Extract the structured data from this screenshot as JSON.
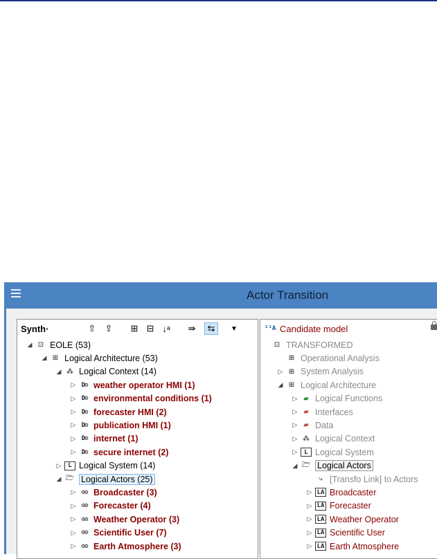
{
  "dialog": {
    "title": "Actor Transition"
  },
  "left": {
    "toolbar_label": "Synth·",
    "tree": [
      {
        "label": "EOLE (53)",
        "icon": "project-icon",
        "depth": 0,
        "toggle": "open",
        "style": "plain"
      },
      {
        "label": "Logical Architecture (53)",
        "icon": "architecture-icon",
        "depth": 1,
        "toggle": "open",
        "style": "plain"
      },
      {
        "label": "Logical Context (14)",
        "icon": "context-icon",
        "depth": 2,
        "toggle": "open",
        "style": "plain"
      },
      {
        "label": "weather operator HMI (1)",
        "icon": "component-icon",
        "depth": 3,
        "toggle": "closed",
        "style": "red"
      },
      {
        "label": "environmental conditions (1)",
        "icon": "component-icon",
        "depth": 3,
        "toggle": "closed",
        "style": "red"
      },
      {
        "label": "forecaster HMI (2)",
        "icon": "component-icon",
        "depth": 3,
        "toggle": "closed",
        "style": "red"
      },
      {
        "label": "publication HMI (1)",
        "icon": "component-icon",
        "depth": 3,
        "toggle": "closed",
        "style": "red"
      },
      {
        "label": "internet (1)",
        "icon": "component-icon",
        "depth": 3,
        "toggle": "closed",
        "style": "red"
      },
      {
        "label": "secure internet (2)",
        "icon": "component-icon",
        "depth": 3,
        "toggle": "closed",
        "style": "red"
      },
      {
        "label": "Logical System (14)",
        "icon": "logical-system-icon",
        "depth": 2,
        "toggle": "closed",
        "style": "plain"
      },
      {
        "label": "Logical Actors (25)",
        "icon": "folder-open-icon",
        "depth": 2,
        "toggle": "open",
        "style": "selected"
      },
      {
        "label": "Broadcaster (3)",
        "icon": "actor-icon",
        "depth": 3,
        "toggle": "closed",
        "style": "red"
      },
      {
        "label": "Forecaster (4)",
        "icon": "actor-icon",
        "depth": 3,
        "toggle": "closed",
        "style": "red"
      },
      {
        "label": "Weather Operator (3)",
        "icon": "actor-icon",
        "depth": 3,
        "toggle": "closed",
        "style": "red"
      },
      {
        "label": "Scientific User (7)",
        "icon": "actor-icon",
        "depth": 3,
        "toggle": "closed",
        "style": "red"
      },
      {
        "label": "Earth Atmosphere (3)",
        "icon": "actor-icon",
        "depth": 3,
        "toggle": "closed",
        "style": "red"
      }
    ]
  },
  "right": {
    "toolbar_label": "Candidate model",
    "toolbar_icon_text": "¹¹A",
    "tree": [
      {
        "label": "TRANSFORMED",
        "icon": "project-icon",
        "depth": 0,
        "toggle": "none",
        "style": "gray"
      },
      {
        "label": "Operational Analysis",
        "icon": "architecture-icon",
        "depth": 1,
        "toggle": "none",
        "style": "gray"
      },
      {
        "label": "System Analysis",
        "icon": "architecture-icon",
        "depth": 1,
        "toggle": "closed",
        "style": "gray"
      },
      {
        "label": "Logical Architecture",
        "icon": "architecture-icon",
        "depth": 1,
        "toggle": "open",
        "style": "gray"
      },
      {
        "label": "Logical Functions",
        "icon": "folder-green-icon",
        "depth": 2,
        "toggle": "closed",
        "style": "gray"
      },
      {
        "label": "Interfaces",
        "icon": "folder-pink-icon",
        "depth": 2,
        "toggle": "closed",
        "style": "gray"
      },
      {
        "label": "Data",
        "icon": "folder-pink-icon",
        "depth": 2,
        "toggle": "closed",
        "style": "gray"
      },
      {
        "label": "Logical Context",
        "icon": "context-icon",
        "depth": 2,
        "toggle": "closed",
        "style": "gray"
      },
      {
        "label": "Logical System",
        "icon": "logical-system-icon",
        "depth": 2,
        "toggle": "closed",
        "style": "gray"
      },
      {
        "label": "Logical Actors",
        "icon": "folder-open-icon",
        "depth": 2,
        "toggle": "open",
        "style": "selected-gray"
      },
      {
        "label": "[Transfo Link] to Actors",
        "icon": "transfo-link-icon",
        "depth": 3,
        "toggle": "none",
        "style": "gray"
      },
      {
        "label": "Broadcaster",
        "icon": "actor-la-icon",
        "depth": 3,
        "toggle": "closed",
        "style": "darkred"
      },
      {
        "label": "Forecaster",
        "icon": "actor-la-icon",
        "depth": 3,
        "toggle": "closed",
        "style": "darkred"
      },
      {
        "label": "Weather Operator",
        "icon": "actor-la-icon",
        "depth": 3,
        "toggle": "closed",
        "style": "darkred"
      },
      {
        "label": "Scientific User",
        "icon": "actor-la-icon",
        "depth": 3,
        "toggle": "closed",
        "style": "darkred"
      },
      {
        "label": "Earth Atmosphere",
        "icon": "actor-la-icon",
        "depth": 3,
        "toggle": "closed",
        "style": "darkred"
      }
    ]
  },
  "colors": {
    "title_bar": "#4b83c3",
    "red_label": "#8b0000",
    "gray_label": "#8a8a8a"
  }
}
